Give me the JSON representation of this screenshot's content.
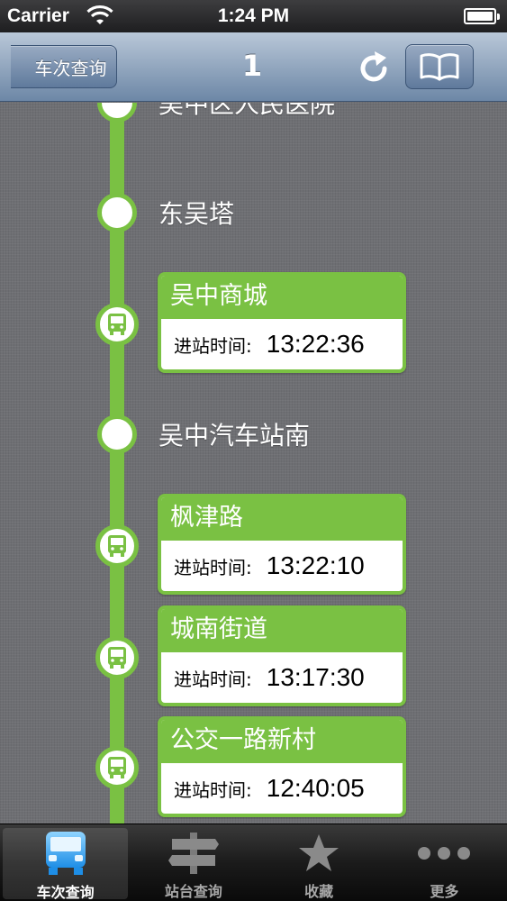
{
  "status_bar": {
    "carrier": "Carrier",
    "time": "1:24 PM"
  },
  "nav": {
    "back_label": "车次查询",
    "title": "1",
    "refresh_icon": "refresh-icon",
    "book_icon": "book-icon"
  },
  "colors": {
    "route_green": "#7ac143",
    "nav_blue": "#7b93b1"
  },
  "route": {
    "partial_station": "吴中区人民医院",
    "stations": [
      {
        "name": "东吴塔",
        "has_bus": false
      },
      {
        "name": "吴中商城",
        "has_bus": true,
        "arrive_label": "进站时间:",
        "arrive_time": "13:22:36"
      },
      {
        "name": "吴中汽车站南",
        "has_bus": false
      },
      {
        "name": "枫津路",
        "has_bus": true,
        "arrive_label": "进站时间:",
        "arrive_time": "13:22:10"
      },
      {
        "name": "城南街道",
        "has_bus": true,
        "arrive_label": "进站时间:",
        "arrive_time": "13:17:30"
      },
      {
        "name": "公交一路新村",
        "has_bus": true,
        "arrive_label": "进站时间:",
        "arrive_time": "12:40:05"
      }
    ]
  },
  "tabs": [
    {
      "label": "车次查询",
      "icon": "bus-icon",
      "active": true
    },
    {
      "label": "站台查询",
      "icon": "bus-stop-sign-icon",
      "active": false
    },
    {
      "label": "收藏",
      "icon": "star-icon",
      "active": false
    },
    {
      "label": "更多",
      "icon": "more-dots-icon",
      "active": false
    }
  ]
}
